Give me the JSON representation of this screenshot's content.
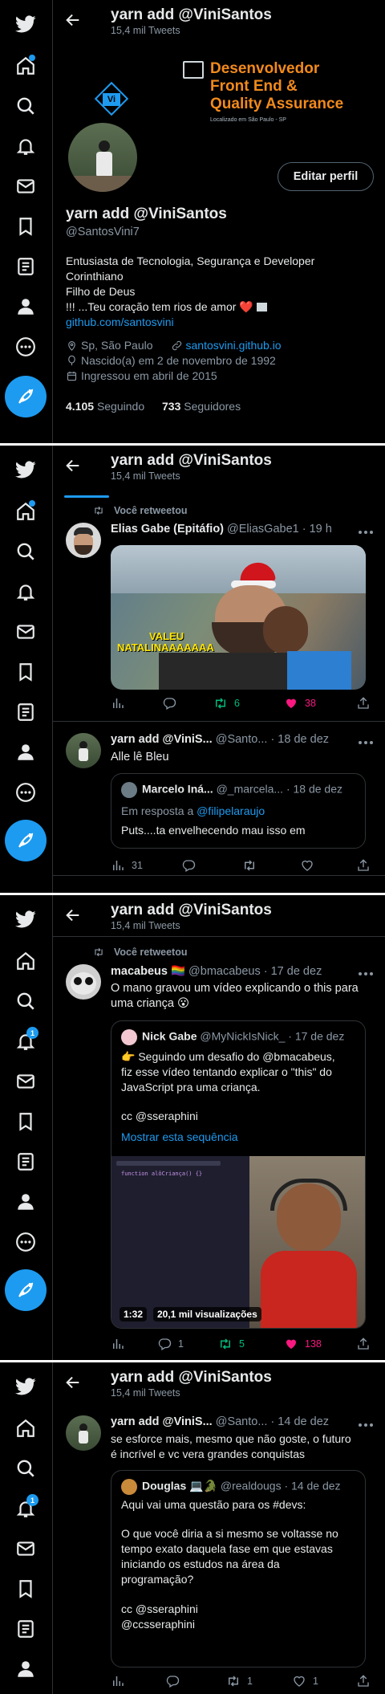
{
  "header": {
    "name": "yarn add @ViniSantos",
    "tweet_count": "15,4 mil Tweets"
  },
  "profile": {
    "banner_title": "Desenvolvedor Front End & Quality Assurance",
    "banner_title_1": "Desenvolvedor",
    "banner_title_2": "Front End &",
    "banner_title_3": "Quality Assurance",
    "banner_location": "Localizado em São Paulo - SP",
    "edit_label": "Editar perfil",
    "name": "yarn add @ViniSantos",
    "handle": "@SantosVini7",
    "bio_1": "Entusiasta de Tecnologia, Segurança e Developer",
    "bio_2": "Corinthiano",
    "bio_3": "Filho de Deus",
    "bio_4": "!!! ...Teu coração tem rios de amor ❤️",
    "bio_link": "github.com/santosvini",
    "location": "Sp, São Paulo",
    "website": "santosvini.github.io",
    "birth": "Nascido(a) em 2 de novembro de 1992",
    "joined": "Ingressou em abril de 2015",
    "following_count": "4.105",
    "following_label": "Seguindo",
    "followers_count": "733",
    "followers_label": "Seguidores"
  },
  "retweeted_label": "Você retweetou",
  "tweet1": {
    "name": "Elias Gabe (Epitáfio)",
    "handle": "@EliasGabe1",
    "time": "· 19 h",
    "image_caption_1": "VALEU",
    "image_caption_2": "NATALINAAAAAAA",
    "retweets": "6",
    "likes": "38"
  },
  "tweet2": {
    "name": "yarn add @ViniS...",
    "handle": "@Santo...",
    "time": "· 18 de dez",
    "text": "Alle lê Bleu",
    "quote_name": "Marcelo Iná...",
    "quote_handle": "@_marcela...",
    "quote_time": "· 18 de dez",
    "quote_reply_prefix": "Em resposta a",
    "quote_reply_to": "@filipelaraujo",
    "quote_text": "Puts....ta envelhecendo mau isso em",
    "views": "31"
  },
  "tweet3": {
    "name": "macabeus 🏳️‍🌈",
    "handle": "@bmacabeus",
    "time": "· 17 de dez",
    "text_1": "O mano gravou um vídeo explicando o this para",
    "text_2": "uma criança 😮",
    "quote_name": "Nick Gabe",
    "quote_handle": "@MyNickIsNick_",
    "quote_time": "· 17 de dez",
    "quote_text_1": "👉 Seguindo um desafio do @bmacabeus,",
    "quote_text_2": "fiz esse vídeo tentando explicar o \"this\" do",
    "quote_text_3": "JavaScript pra uma criança.",
    "quote_cc": "cc @sseraphini",
    "show_thread": "Mostrar esta sequência",
    "video_code": "function alôCriança() {}",
    "video_duration": "1:32",
    "video_views": "20,1 mil visualizações",
    "replies": "1",
    "retweets": "5",
    "likes": "138"
  },
  "tweet4": {
    "name": "yarn add @ViniS...",
    "handle": "@Santo...",
    "time": "· 14 de dez",
    "text_1": "se esforce mais, mesmo que não goste, o futuro",
    "text_2": "é incrível e vc vera grandes conquistas",
    "quote_name": "Douglas 💻🐊",
    "quote_handle": "@realdougs",
    "quote_time": "· 14 de dez",
    "quote_text_1": "Aqui vai uma questão para os #devs:",
    "quote_text_2": "O que você diria a si mesmo se voltasse no",
    "quote_text_3": "tempo exato daquela fase em que estavas",
    "quote_text_4": "iniciando os estudos na área da",
    "quote_text_5": "programação?",
    "quote_cc_1": "cc @sseraphini",
    "quote_cc_2": "@ccsseraphini",
    "retweets": "1",
    "likes": "1"
  },
  "notifications_badge": "1",
  "colors": {
    "accent": "#1d9bf0",
    "retweet": "#00ba7c",
    "like": "#f91880",
    "banner_orange": "#f28a1c"
  }
}
